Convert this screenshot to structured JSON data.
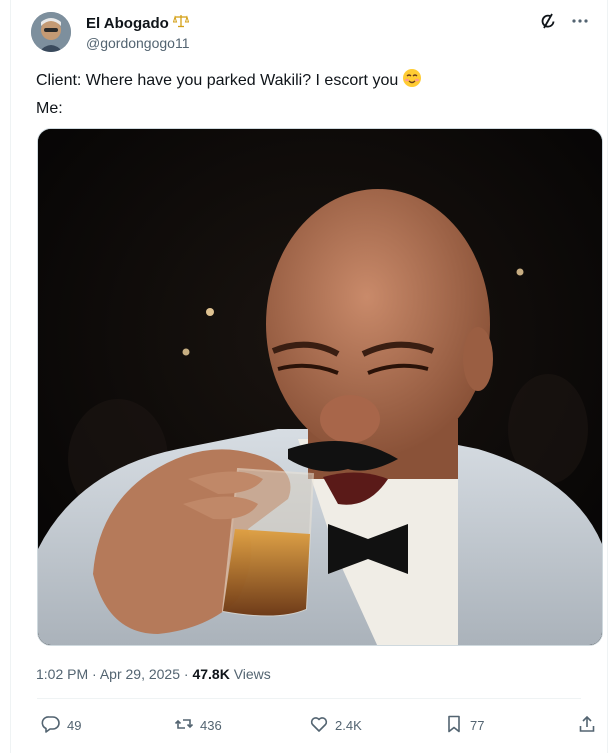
{
  "author": {
    "display_name": "El Abogado",
    "handle": "@gordongogo11",
    "badge_icon": "scales-of-justice-icon"
  },
  "tweet": {
    "line1": "Client: Where have you parked Wakili? I escort you",
    "line1_emoji": "smiling-face-icon",
    "line2": "Me:"
  },
  "meta": {
    "time": "1:02 PM",
    "sep1": "·",
    "date": "Apr 29, 2025",
    "sep2": "·",
    "views_count": "47.8K",
    "views_label": "Views"
  },
  "actions": {
    "replies": "49",
    "reposts": "436",
    "likes": "2.4K",
    "bookmarks": "77"
  },
  "colors": {
    "text": "#0f1419",
    "muted": "#536471",
    "border": "#eff3f4"
  }
}
